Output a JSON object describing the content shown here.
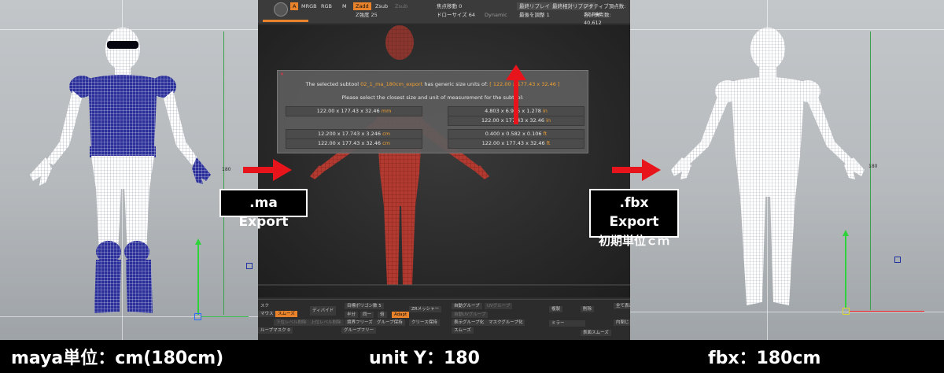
{
  "captions": {
    "left": "maya単位：cm(180cm)",
    "center": "unit Y：180",
    "right": "fbx：180cm"
  },
  "labels": {
    "ma_export": ".ma Export",
    "fbx_export": ".fbx Export",
    "fbx_unit": "初期単位ｃｍ"
  },
  "colors": {
    "arrow": "#e8141b",
    "accent": "#e8822b",
    "maya_wire": "#1a1f7a"
  },
  "maya_view": {
    "height_marker": "180"
  },
  "fbx_view": {
    "height_marker": "180"
  },
  "zbrush": {
    "top_bar": {
      "mode_a": "A",
      "mrgb": "MRGB",
      "rgb": "RGB",
      "m": "M",
      "zadd": "Zadd",
      "zsub": "Zsub",
      "zsub2": "Zsub",
      "z_intensity": "Z強度 25",
      "focal_shift": "焦点移動 0",
      "draw_size": "ドローサイズ 64",
      "dynamic": "Dynamic",
      "best_replay": "最終リプレイ",
      "best_relative_replay": "最終相対リプレイ",
      "active_points": "アクティブ頂点数: 32,546",
      "adjust_last": "最後を調整 1",
      "total_points": "合計頂点数: 40,612"
    },
    "dialog": {
      "line1_prefix": "The selected subtool",
      "subtool_name": "02_1_ma_180cm_export",
      "line1_mid": "has generic size units of:",
      "generic_size": "[ 122.00 x 177.43 x 32.46 ]",
      "line2": "Please select the closest size and unit of measurement for the subtool:",
      "options": [
        {
          "value": "122.00 x 177.43 x 32.46",
          "unit": "mm"
        },
        {
          "value": "4.803 x 6.985 x 1.278",
          "unit": "in"
        },
        {
          "value": "122.00 x 177.43 x 32.46",
          "unit": "in"
        },
        {
          "value": "12.200 x 17.743 x 3.246",
          "unit": "cm"
        },
        {
          "value": "0.400 x 0.582 x 0.106",
          "unit": "ft"
        },
        {
          "value": "122.00 x 177.43 x 32.46",
          "unit": "cm"
        },
        {
          "value": "122.00 x 177.43 x 32.46",
          "unit": "ft"
        }
      ]
    },
    "bottom": {
      "mask": "スク",
      "mask_mouse": "マウス",
      "smooth": "スムーズ",
      "divide": "ディバイド",
      "target_poly": "目標ポリゴン数 5",
      "zremesher": "ZRメッシャー",
      "half": "半分",
      "same": "同一",
      "double": "倍",
      "adapt": "Adapt",
      "border_freeze": "境界フリーズ",
      "group_keep": "グループ保持",
      "crease_keep": "クリース保持",
      "group_free": "グループフリー",
      "auto_group": "自動グループ",
      "uv_group": "UVグループ",
      "auto_uv_group": "自動UVグループ",
      "display_group": "表示グループ化",
      "mask_group": "マスクグループ化",
      "smooth2": "スムーズ",
      "copy": "複製",
      "delete": "削除",
      "mirror": "ミラー",
      "display_smooth": "表面スムーズ",
      "all_show": "全て表示",
      "inner_delete": "内閉じ",
      "group_mask": "ループマスク 0",
      "lower_res": "下位レベル削除",
      "upper_res": "上位レベル削除"
    }
  }
}
